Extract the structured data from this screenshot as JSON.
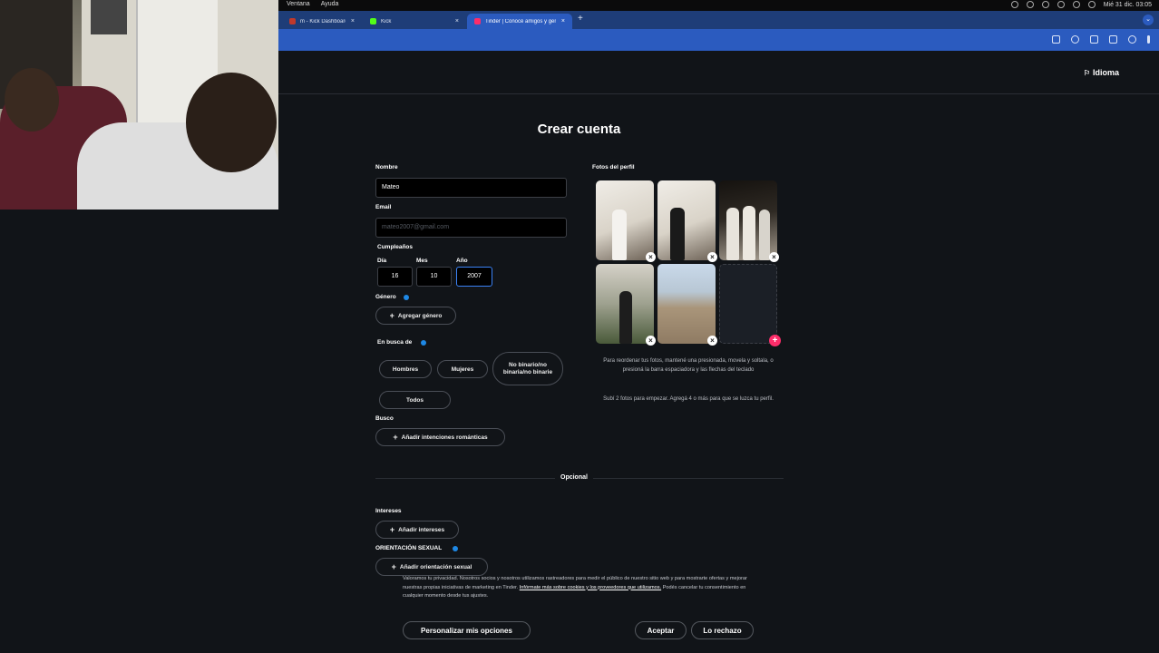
{
  "menubar": {
    "menus": [
      "Ventana",
      "Ayuda"
    ],
    "clock": "Mié 31 dic. 03:05"
  },
  "tabs": [
    {
      "label": "m - Kick Dashboard",
      "favicon_color": "#c0392b",
      "active": false
    },
    {
      "label": "Kick",
      "favicon_color": "#53fc18",
      "active": false
    },
    {
      "label": "Tinder | Conocé amigos y gen",
      "favicon_color": "#fd2d6a",
      "active": true
    }
  ],
  "page": {
    "language_label": "Idioma",
    "title": "Crear cuenta",
    "name": {
      "label": "Nombre",
      "value": "Mateo"
    },
    "email": {
      "label": "Email",
      "placeholder": "mateo2007@gmail.com"
    },
    "birthday": {
      "label": "Cumpleaños",
      "day_label": "Día",
      "day": "16",
      "month_label": "Mes",
      "month": "10",
      "year_label": "Año",
      "year": "2007"
    },
    "gender": {
      "label": "Género",
      "add_label": "Agregar género"
    },
    "looking_for": {
      "label": "En busca de",
      "options": [
        "Hombres",
        "Mujeres",
        "No binario/no binaria/no binarie",
        "Todos"
      ]
    },
    "seeking": {
      "label": "Busco",
      "add_label": "Añadir intenciones románticas"
    },
    "optional_label": "Opcional",
    "interests": {
      "label": "Intereses",
      "add_label": "Añadir intereses"
    },
    "orientation": {
      "label": "ORIENTACIÓN SEXUAL",
      "add_label": "Añadir orientación sexual"
    },
    "photos": {
      "label": "Fotos del perfil",
      "reorder_note": "Para reordenar tus fotos, mantené una presionada, movela y soltala, o presioná la barra espaciadora y las flechas del teclado",
      "upload_note": "Subí 2 fotos para empezar. Agregá 4 o más para que se luzca tu perfil."
    }
  },
  "cookie_banner": {
    "text": "Valoramos tu privacidad. Nosotros socios y nosotros utilizamos rastreadores para medir el público de nuestro sitio web y para mostrarte ofertas y mejorar nuestras propias iniciativas de marketing en Tinder.",
    "link": "Infórmate más sobre cookies y los proveedores que utilizamos.",
    "text2": "Podés cancelar tu consentimiento en cualquier momento desde tus ajustes.",
    "customize_label": "Personalizar mis opciones",
    "accept_label": "Aceptar",
    "reject_label": "Lo rechazo"
  }
}
